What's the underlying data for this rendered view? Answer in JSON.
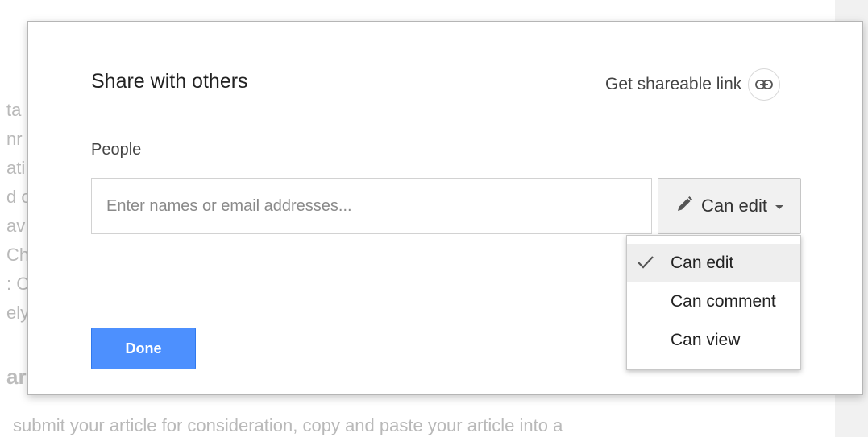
{
  "background": {
    "fragments": [
      "ta",
      "nr",
      "ati",
      "d c",
      "av",
      "Ch",
      ": C",
      "ely"
    ],
    "heading": "ar",
    "bottom_text": "submit your article for consideration, copy and paste your article into a"
  },
  "dialog": {
    "title": "Share with others",
    "share_link_label": "Get shareable link",
    "share_link_icon": "link-icon",
    "people_label": "People",
    "input": {
      "placeholder": "Enter names or email addresses...",
      "value": ""
    },
    "permission_button": {
      "icon": "pencil-icon",
      "label": "Can edit"
    },
    "menu": {
      "items": [
        {
          "label": "Can edit",
          "selected": true
        },
        {
          "label": "Can comment",
          "selected": false
        },
        {
          "label": "Can view",
          "selected": false
        }
      ]
    },
    "done_label": "Done"
  },
  "colors": {
    "primary_button": "#4d90fe",
    "selected_item": "#eeeeee"
  }
}
